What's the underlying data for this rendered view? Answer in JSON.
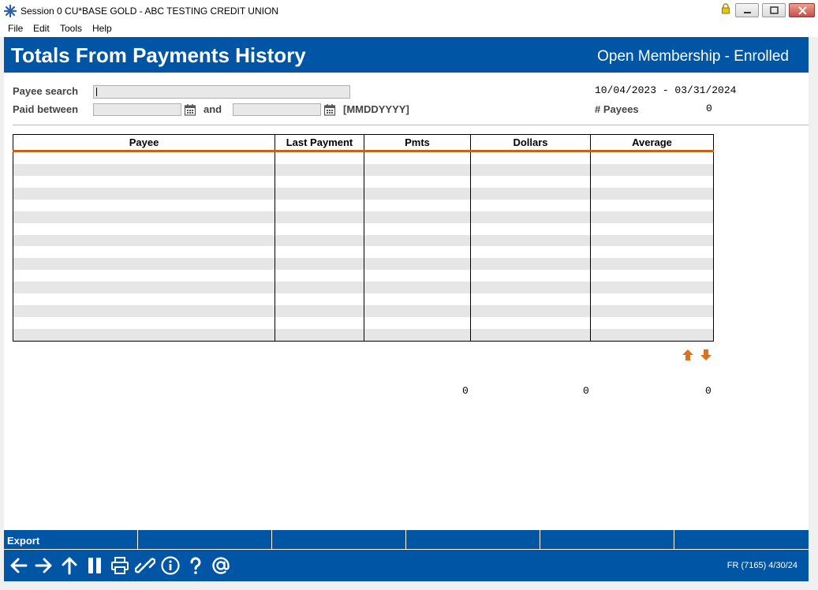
{
  "window": {
    "title": "Session 0 CU*BASE GOLD - ABC TESTING CREDIT UNION"
  },
  "menu": [
    "File",
    "Edit",
    "Tools",
    "Help"
  ],
  "header": {
    "title": "Totals From Payments History",
    "status": "Open Membership - Enrolled"
  },
  "form": {
    "payee_search_label": "Payee search",
    "payee_search_value": "",
    "paid_between_label": "Paid between",
    "from_date_value": "",
    "and_label": "and",
    "to_date_value": "",
    "date_format_hint": "[MMDDYYYY]",
    "date_range": "10/04/2023 - 03/31/2024",
    "payees_label": "# Payees",
    "payees_count": "0"
  },
  "table": {
    "columns": [
      "Payee",
      "Last Payment",
      "Pmts",
      "Dollars",
      "Average"
    ],
    "rows": []
  },
  "totals": {
    "pmts": "0",
    "dollars": "0",
    "average": "0"
  },
  "fkeys": [
    "Export",
    "",
    "",
    "",
    "",
    ""
  ],
  "footer": {
    "program_info": "FR (7165) 4/30/24"
  },
  "colors": {
    "brand_blue": "#0055a5",
    "accent_orange": "#c06418"
  }
}
